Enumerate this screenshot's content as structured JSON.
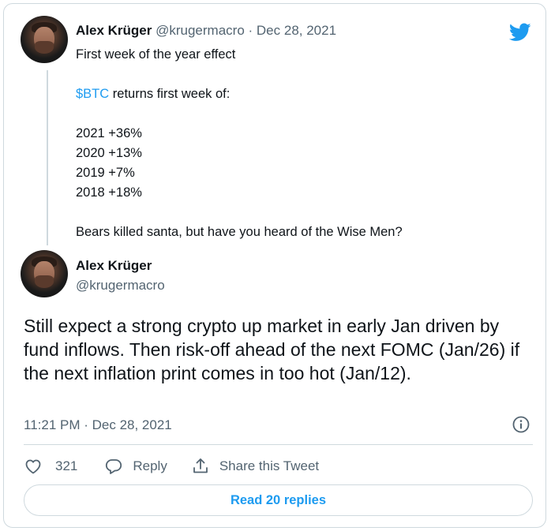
{
  "quoted_tweet": {
    "author_name": "Alex Krüger",
    "handle": "@krugermacro",
    "date": " · Dec 28, 2021",
    "lines": {
      "l1": "First week of the year effect",
      "cashtag": "$BTC",
      "l2_rest": " returns first week of:",
      "y2021": "2021 +36%",
      "y2020": "2020 +13%",
      "y2019": "2019 +7%",
      "y2018": "2018 +18%",
      "closing": "Bears killed santa, but have you heard of the Wise Men?"
    }
  },
  "main_tweet": {
    "author_name": "Alex Krüger",
    "handle": "@krugermacro",
    "text": "Still expect a strong crypto up market in early Jan driven by fund inflows. Then risk-off ahead of the next FOMC (Jan/26) if the next inflation print comes in too hot (Jan/12).",
    "timestamp": "11:21 PM · Dec 28, 2021"
  },
  "actions": {
    "like_count": "321",
    "reply_label": "Reply",
    "share_label": "Share this Tweet"
  },
  "replies_button": "Read 20 replies",
  "colors": {
    "accent": "#1d9bf0",
    "text": "#0f1419",
    "muted": "#536471",
    "border": "#cfd9de"
  },
  "icons": [
    "twitter-bird-icon",
    "info-icon",
    "heart-icon",
    "reply-icon",
    "share-icon"
  ]
}
